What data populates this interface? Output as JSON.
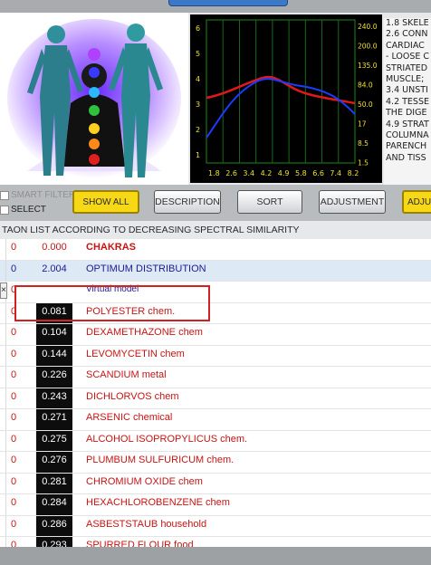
{
  "graph": {
    "left_ticks": [
      "6",
      "5",
      "4",
      "3",
      "2",
      "1"
    ],
    "right_ticks": [
      "240.0",
      "200.0",
      "135.0",
      "84.0",
      "50.0",
      "17",
      "8.5",
      "1.5"
    ],
    "x_ticks": [
      "1.8",
      "2.6",
      "3.4",
      "4.2",
      "4.9",
      "5.8",
      "6.6",
      "7.4",
      "8.2"
    ]
  },
  "text_panel": {
    "lines": [
      "1.8 SKELE",
      "2.6 CONN",
      "CARDIAC",
      "- LOOSE C",
      "STRIATED",
      "MUSCLE;",
      "3.4 UNSTI",
      "4.2 TESSE",
      "THE DIGE",
      "4.9 STRAT",
      "COLUMNA",
      "PARENCH",
      "AND TISS"
    ]
  },
  "controls": {
    "smart_filter": "SMART FILTER",
    "select": "SELECT",
    "show_all": "SHOW ALL",
    "description": "DESCRIPTION",
    "sort": "SORT",
    "adjustment": "ADJUSTMENT",
    "adjust_cut": "ADJU"
  },
  "heading": "TAON LIST ACCORDING TO DECREASING SPECTRAL SIMILARITY",
  "rows": [
    {
      "idx": "0",
      "value": "0.000",
      "name": "CHAKRAS"
    },
    {
      "idx": "0",
      "value": "2.004",
      "name": "OPTIMUM DISTRIBUTION"
    },
    {
      "idx": "0",
      "value": "",
      "name": "Virtual model"
    },
    {
      "idx": "0",
      "value": "0.081",
      "name": "POLYESTER  chem."
    },
    {
      "idx": "0",
      "value": "0.104",
      "name": "DEXAMETHAZONE chem"
    },
    {
      "idx": "0",
      "value": "0.144",
      "name": "LEVOMYCETIN chem"
    },
    {
      "idx": "0",
      "value": "0.226",
      "name": "SCANDIUM metal"
    },
    {
      "idx": "0",
      "value": "0.243",
      "name": "DICHLORVOS chem"
    },
    {
      "idx": "0",
      "value": "0.271",
      "name": "ARSENIC  chemical"
    },
    {
      "idx": "0",
      "value": "0.275",
      "name": "ALCOHOL  ISOPROPYLICUS  chem."
    },
    {
      "idx": "0",
      "value": "0.276",
      "name": "PLUMBUM  SULFURICUM  chem."
    },
    {
      "idx": "0",
      "value": "0.281",
      "name": "CHROMIUM OXIDE chem"
    },
    {
      "idx": "0",
      "value": "0.284",
      "name": "HEXACHLOROBENZENE chem"
    },
    {
      "idx": "0",
      "value": "0.286",
      "name": "ASBESTSTAUB  household"
    },
    {
      "idx": "0",
      "value": "0.293",
      "name": "SPURRED FLOUR food"
    }
  ],
  "close_mark": "×"
}
